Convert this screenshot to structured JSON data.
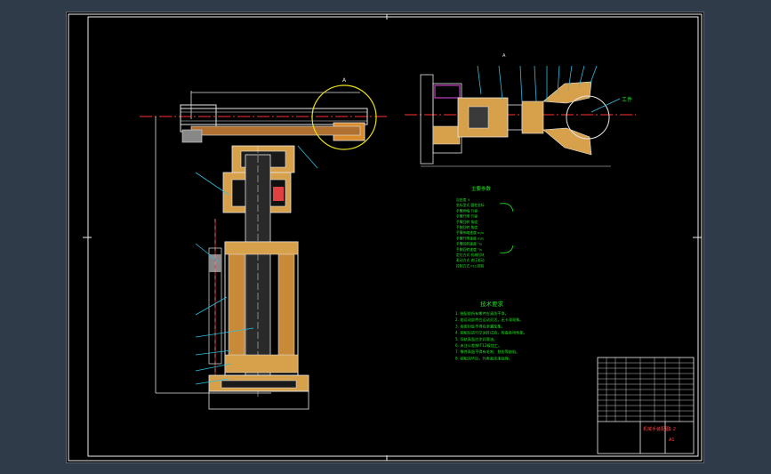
{
  "drawing": {
    "callout_letter_a": "A",
    "callout_letter_b": "A",
    "gripper_label": "工件",
    "spec_title": "主要参数",
    "spec_lines": [
      "自由度  4",
      "坐标型式  圆柱坐标",
      "手臂伸缩  行程",
      "手臂升降  行程",
      "手臂回转  角度",
      "手腕回转  角度",
      "手臂伸缩速度  m/s",
      "手臂升降速度  m/s",
      "手臂回转速度  °/s",
      "手腕回转速度  °/s",
      "定位方式  机械挡块",
      "驱动方式  液压驱动",
      "控制方式  PLC控制"
    ],
    "tech_title": "技术要求",
    "tech_lines": [
      "1. 装配前所有零件应清洗干净。",
      "2. 各运动部件应运动灵活，无卡滞现象。",
      "3. 各密封处不得有渗漏现象。",
      "4. 装配后进行空运转试验，检查各项性能。",
      "5. 导轨表面应涂润滑油。",
      "6. 未注公差按IT12级加工。",
      "7. 零件表面不得有毛刺、划伤等缺陷。",
      "8. 装配完毕后，外表面涂漆处理。"
    ],
    "title_block": {
      "drawing_name": "机械手装配图",
      "scale": "1:2",
      "sheet": "A1"
    }
  }
}
